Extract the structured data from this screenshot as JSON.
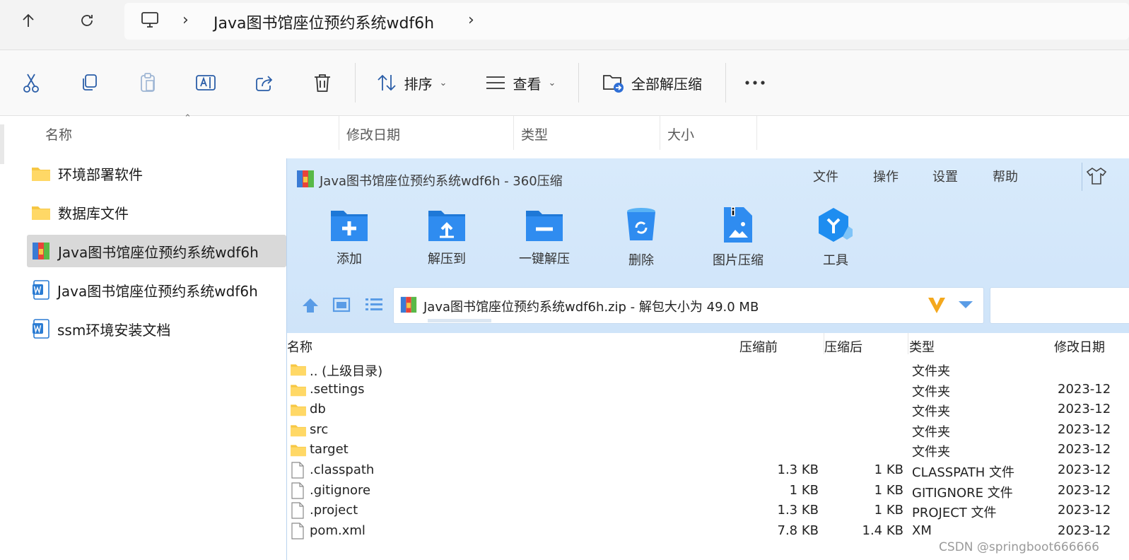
{
  "explorer": {
    "address": {
      "crumb": "Java图书馆座位预约系统wdf6h"
    },
    "toolbar": {
      "sort_label": "排序",
      "view_label": "查看",
      "extract_all_label": "全部解压缩"
    },
    "columns": [
      "名称",
      "修改日期",
      "类型",
      "大小"
    ],
    "files": [
      {
        "name": "环境部署软件",
        "icon": "folder-icon"
      },
      {
        "name": "数据库文件",
        "icon": "folder-icon"
      },
      {
        "name": "Java图书馆座位预约系统wdf6h",
        "icon": "zip-archive-icon",
        "selected": true
      },
      {
        "name": "Java图书馆座位预约系统wdf6h",
        "icon": "word-doc-icon"
      },
      {
        "name": "ssm环境安装文档",
        "icon": "word-doc-icon"
      }
    ]
  },
  "zip_window": {
    "title": "Java图书馆座位预约系统wdf6h - 360压缩",
    "menu": [
      "文件",
      "操作",
      "设置",
      "帮助"
    ],
    "buttons": [
      {
        "label": "添加",
        "icon": "add-folder-icon"
      },
      {
        "label": "解压到",
        "icon": "extract-to-folder-icon"
      },
      {
        "label": "一键解压",
        "icon": "one-click-extract-icon"
      },
      {
        "label": "删除",
        "icon": "recycle-bin-icon"
      },
      {
        "label": "图片压缩",
        "icon": "image-compress-icon"
      },
      {
        "label": "工具",
        "icon": "tools-cube-icon"
      }
    ],
    "path_text": "Java图书馆座位预约系统wdf6h.zip - 解包大小为 49.0 MB",
    "columns": {
      "name": "名称",
      "before": "压缩前",
      "after": "压缩后",
      "type": "类型",
      "modified": "修改日期"
    },
    "rows": [
      {
        "name": ".. (上级目录)",
        "kind": "folder",
        "before": "",
        "after": "",
        "type": "文件夹",
        "modified": ""
      },
      {
        "name": ".settings",
        "kind": "folder",
        "before": "",
        "after": "",
        "type": "文件夹",
        "modified": "2023-12"
      },
      {
        "name": "db",
        "kind": "folder",
        "before": "",
        "after": "",
        "type": "文件夹",
        "modified": "2023-12"
      },
      {
        "name": "src",
        "kind": "folder",
        "before": "",
        "after": "",
        "type": "文件夹",
        "modified": "2023-12"
      },
      {
        "name": "target",
        "kind": "folder",
        "before": "",
        "after": "",
        "type": "文件夹",
        "modified": "2023-12"
      },
      {
        "name": ".classpath",
        "kind": "file",
        "before": "1.3 KB",
        "after": "1 KB",
        "type": "CLASSPATH 文件",
        "modified": "2023-12"
      },
      {
        "name": ".gitignore",
        "kind": "file",
        "before": "1 KB",
        "after": "1 KB",
        "type": "GITIGNORE 文件",
        "modified": "2023-12"
      },
      {
        "name": ".project",
        "kind": "file",
        "before": "1.3 KB",
        "after": "1 KB",
        "type": "PROJECT 文件",
        "modified": "2023-12"
      },
      {
        "name": "pom.xml",
        "kind": "file",
        "before": "7.8 KB",
        "after": "1.4 KB",
        "type": "XM",
        "modified": "2023-12"
      }
    ]
  },
  "watermark": "CSDN @springboot666666"
}
